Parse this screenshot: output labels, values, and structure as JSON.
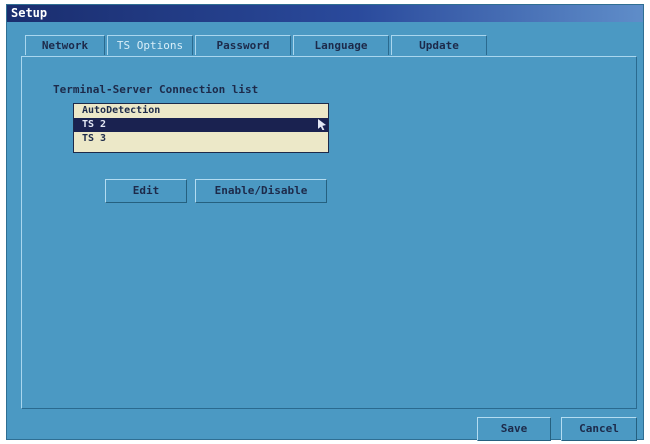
{
  "window": {
    "title": "Setup"
  },
  "tabs": [
    {
      "label": "Network"
    },
    {
      "label": "TS Options"
    },
    {
      "label": "Password"
    },
    {
      "label": "Language"
    },
    {
      "label": "Update"
    }
  ],
  "ts_options": {
    "list_label": "Terminal-Server Connection list",
    "connections": [
      {
        "label": "AutoDetection"
      },
      {
        "label": "TS 2"
      },
      {
        "label": "TS 3"
      }
    ],
    "selected_index": 1,
    "edit_label": "Edit",
    "enable_disable_label": "Enable/Disable"
  },
  "footer": {
    "save_label": "Save",
    "cancel_label": "Cancel"
  }
}
